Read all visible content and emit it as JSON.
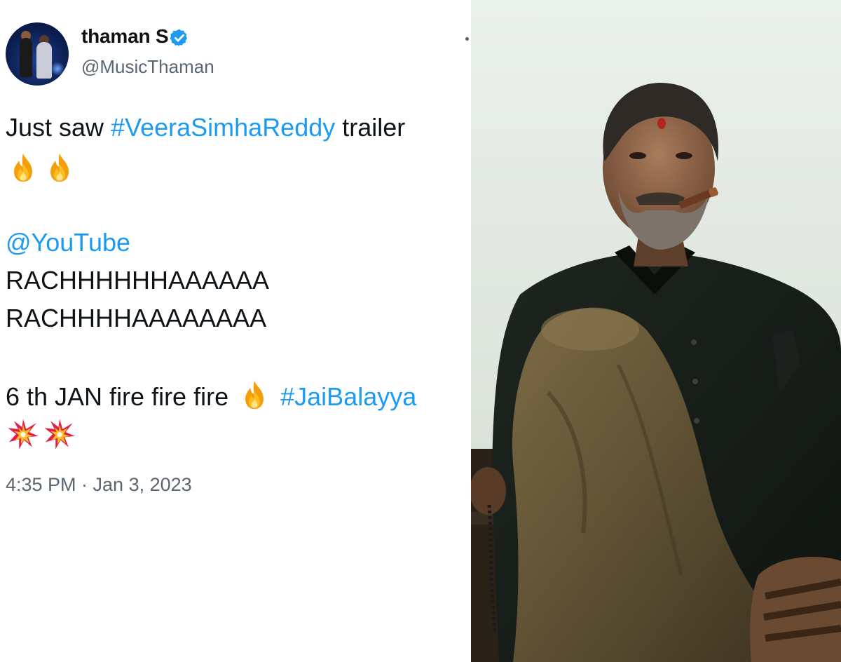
{
  "tweet": {
    "author_name": "thaman S",
    "handle": "@MusicThaman",
    "line1_prefix": "Just saw ",
    "line1_hashtag": "#VeeraSimhaReddy",
    "line1_suffix": " trailer",
    "mention": "@YouTube",
    "line_rach1": "RACHHHHHHAAAAAA",
    "line_rach2": "RACHHHHAAAAAAAA",
    "line_date_text": "6 th JAN fire fire fire ",
    "line_date_hashtag": "#JaiBalayya",
    "timestamp": "4:35 PM · Jan 3, 2023",
    "emojis": {
      "fire": "fire-icon",
      "collision": "collision-icon",
      "verified": "verified-badge-icon"
    }
  },
  "colors": {
    "link": "#1d9bf0",
    "text": "#0f1419",
    "muted": "#5b6671",
    "background": "#ffffff"
  }
}
